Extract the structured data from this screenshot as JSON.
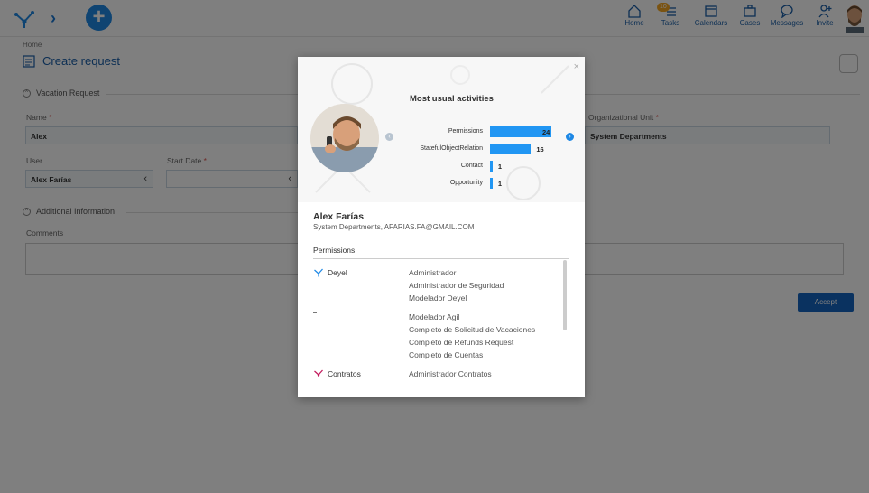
{
  "topbar": {
    "nav": [
      {
        "label": "Home",
        "icon": "home-icon"
      },
      {
        "label": "Tasks",
        "icon": "tasks-icon",
        "badge": "10"
      },
      {
        "label": "Calendars",
        "icon": "calendar-icon"
      },
      {
        "label": "Cases",
        "icon": "briefcase-icon"
      },
      {
        "label": "Messages",
        "icon": "message-icon"
      },
      {
        "label": "Invite",
        "icon": "invite-icon"
      }
    ]
  },
  "page": {
    "breadcrumb": "Home",
    "title": "Create request",
    "sections": {
      "vacation": "Vacation Request",
      "additional": "Additional Information"
    },
    "fields": {
      "name_label": "Name",
      "name_value": "Alex",
      "org_label": "Organizational Unit",
      "org_value": "System Departments",
      "user_label": "User",
      "user_value": "Alex Farías",
      "start_label": "Start Date",
      "comments_label": "Comments"
    },
    "accept_label": "Accept",
    "required_mark": "*"
  },
  "modal": {
    "close": "×",
    "chart_title": "Most usual activities",
    "user_name": "Alex Farías",
    "user_desc": "System Departments, AFARIAS.FA@GMAIL.COM",
    "permissions_title": "Permissions",
    "apps": [
      {
        "name": "Deyel",
        "roles": [
          "Administrador",
          "Administrador de Seguridad",
          "Modelador Deyel"
        ]
      },
      {
        "name": "",
        "roles": [
          "Modelador Agil",
          "Completo de Solicitud de Vacaciones",
          "Completo de Refunds Request",
          "Completo de Cuentas"
        ]
      },
      {
        "name": "Contratos",
        "roles": [
          "Administrador Contratos"
        ]
      }
    ]
  },
  "chart_data": {
    "type": "bar",
    "title": "Most usual activities",
    "categories": [
      "Permissions",
      "StatefulObjectRelation",
      "Contact",
      "Opportunity"
    ],
    "values": [
      24,
      16,
      1,
      1
    ],
    "orientation": "horizontal",
    "color": "#2196f3"
  }
}
